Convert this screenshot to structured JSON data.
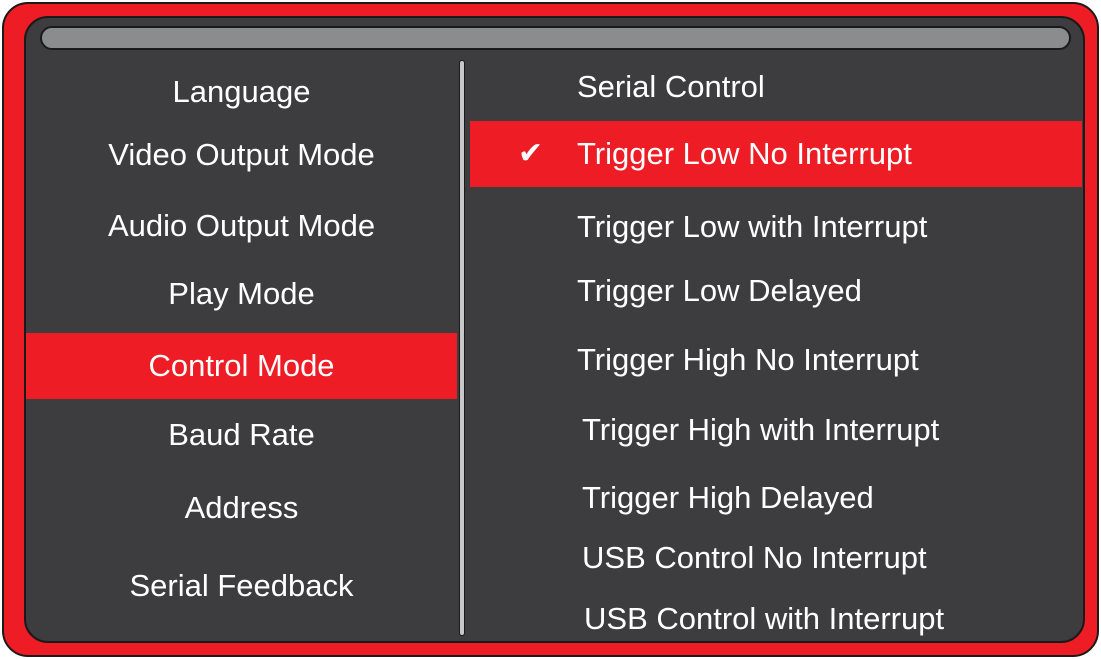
{
  "colors": {
    "accent": "#ee1c25",
    "panel": "#3d3d3f",
    "titlebar": "#8b8c8e",
    "text": "#ffffff"
  },
  "left_menu": {
    "items": [
      {
        "label": "Language"
      },
      {
        "label": "Video Output Mode"
      },
      {
        "label": "Audio Output Mode"
      },
      {
        "label": "Play Mode"
      },
      {
        "label": "Control Mode"
      },
      {
        "label": "Baud Rate"
      },
      {
        "label": "Address"
      },
      {
        "label": "Serial Feedback"
      }
    ],
    "selected": "Control Mode"
  },
  "right_menu": {
    "items": [
      {
        "label": "Serial Control"
      },
      {
        "label": "Trigger Low No Interrupt"
      },
      {
        "label": "Trigger Low with Interrupt"
      },
      {
        "label": "Trigger Low Delayed"
      },
      {
        "label": "Trigger High No Interrupt"
      },
      {
        "label": "Trigger High with Interrupt"
      },
      {
        "label": "Trigger High Delayed"
      },
      {
        "label": "USB Control No Interrupt"
      },
      {
        "label": "USB Control with Interrupt"
      }
    ],
    "selected": "Trigger Low No Interrupt",
    "check_icon": "check-icon"
  }
}
